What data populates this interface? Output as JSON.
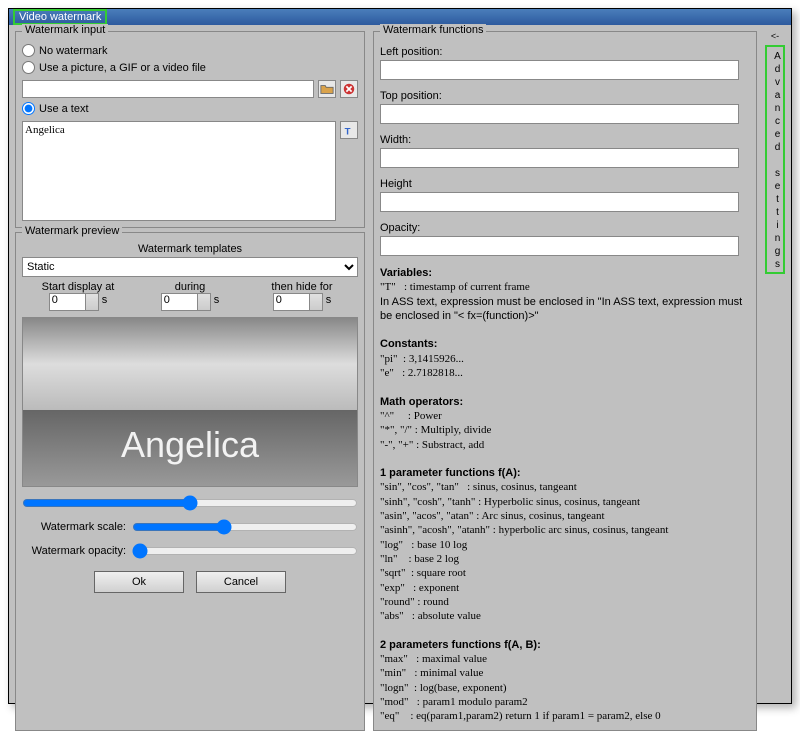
{
  "window": {
    "title": "Video watermark"
  },
  "input_group": {
    "title": "Watermark input",
    "opt_none": "No watermark",
    "opt_file": "Use a picture, a GIF or a video file",
    "opt_text": "Use a text",
    "text_value": "Angelica"
  },
  "preview_group": {
    "title": "Watermark preview",
    "templates_label": "Watermark templates",
    "template_selected": "Static",
    "start_label": "Start display at",
    "during_label": "during",
    "hide_label": "then hide for",
    "start_val": "0",
    "during_val": "0",
    "hide_val": "0",
    "unit": "s",
    "scale_label": "Watermark scale:",
    "opacity_label": "Watermark opacity:",
    "wm_text": "Angelica"
  },
  "buttons": {
    "ok": "Ok",
    "cancel": "Cancel"
  },
  "functions_group": {
    "title": "Watermark functions",
    "left": "Left position:",
    "top": "Top position:",
    "width": "Width:",
    "height": "Height",
    "opacity": "Opacity:"
  },
  "doc": {
    "variables_h": "Variables:",
    "var_t": "\"T\"   : timestamp of current frame",
    "var_note": "In ASS text, expression must be enclosed in \"In ASS text, expression must be enclosed in \"< fx=(function)>\"",
    "const_h": "Constants:",
    "const_pi": "\"pi\"  : 3,1415926...",
    "const_e": "\"e\"   : 2.7182818...",
    "math_h": "Math operators:",
    "math_pow": "\"^\"     : Power",
    "math_mul": "\"*\", \"/\" : Multiply, divide",
    "math_sub": "\"-\", \"+\" : Substract, add",
    "f1_h": "1 parameter functions f(A):",
    "f1_sin": "\"sin\", \"cos\", \"tan\"   : sinus, cosinus, tangeant",
    "f1_sinh": "\"sinh\", \"cosh\", \"tanh\" : Hyperbolic sinus, cosinus, tangeant",
    "f1_asin": "\"asin\", \"acos\", \"atan\" : Arc sinus, cosinus, tangeant",
    "f1_asinh": "\"asinh\", \"acosh\", \"atanh\" : hyperbolic arc sinus, cosinus, tangeant",
    "f1_log": "\"log\"   : base 10 log",
    "f1_ln": "\"ln\"    : base 2 log",
    "f1_sqrt": "\"sqrt\"  : square root",
    "f1_exp": "\"exp\"   : exponent",
    "f1_round": "\"round\" : round",
    "f1_abs": "\"abs\"   : absolute value",
    "f2_h": "2 parameters functions f(A, B):",
    "f2_max": "\"max\"   : maximal value",
    "f2_min": "\"min\"   : minimal value",
    "f2_logn": "\"logn\"  : log(base, exponent)",
    "f2_mod": "\"mod\"   : param1 modulo param2",
    "f2_eq": "\"eq\"    : eq(param1,param2) return 1 if param1 = param2, else 0"
  },
  "side": {
    "arrow": "<-",
    "label": "Advanced settings"
  }
}
